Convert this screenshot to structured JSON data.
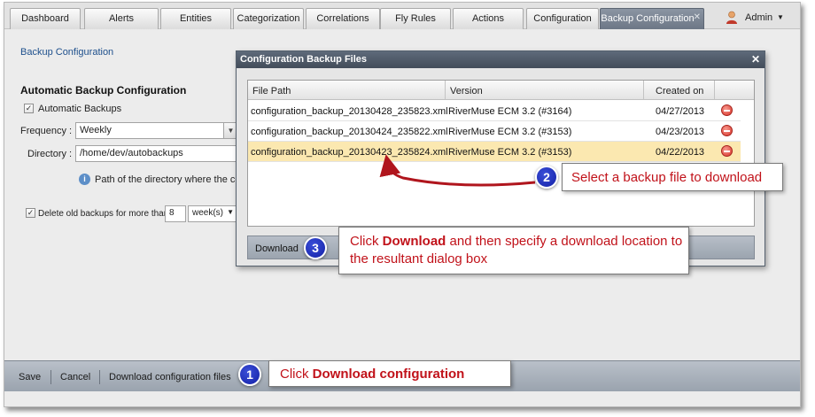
{
  "tabs": [
    {
      "label": "Dashboard",
      "active": false
    },
    {
      "label": "Alerts",
      "active": false
    },
    {
      "label": "Entities",
      "active": false
    },
    {
      "label": "Categorization",
      "active": false
    },
    {
      "label": "Correlations",
      "active": false
    },
    {
      "label": "Fly Rules",
      "active": false
    },
    {
      "label": "Actions",
      "active": false
    },
    {
      "label": "Configuration",
      "active": false
    },
    {
      "label": "Backup Configuration",
      "active": true
    }
  ],
  "user": {
    "name": "Admin",
    "icon": "user-icon"
  },
  "page": {
    "breadcrumb": "Backup Configuration",
    "section_title": "Automatic Backup Configuration",
    "automatic_backups_label": "Automatic Backups",
    "automatic_backups_checked": true,
    "frequency_label": "Frequency :",
    "frequency_value": "Weekly",
    "directory_label": "Directory :",
    "directory_value": "/home/dev/autobackups",
    "directory_help": "Path of the directory where the co",
    "delete_old_label": "Delete old backups for more than",
    "delete_old_checked": true,
    "delete_old_count": "8",
    "delete_old_unit": "week(s)"
  },
  "toolbar": {
    "save_label": "Save",
    "cancel_label": "Cancel",
    "download_config_label": "Download configuration files"
  },
  "modal": {
    "title": "Configuration Backup Files",
    "columns": [
      "File Path",
      "Version",
      "Created on"
    ],
    "rows": [
      {
        "file": "configuration_backup_20130428_235823.xml",
        "version": "RiverMuse ECM 3.2 (#3164)",
        "created": "04/27/2013",
        "selected": false
      },
      {
        "file": "configuration_backup_20130424_235822.xml",
        "version": "RiverMuse ECM 3.2 (#3153)",
        "created": "04/23/2013",
        "selected": false
      },
      {
        "file": "configuration_backup_20130423_235824.xml",
        "version": "RiverMuse ECM 3.2 (#3153)",
        "created": "04/22/2013",
        "selected": true
      }
    ],
    "download_label": "Download"
  },
  "callouts": [
    {
      "number": "1",
      "text_prefix": "Click ",
      "text_bold": "Download configuration",
      "text_suffix": ""
    },
    {
      "number": "2",
      "text_prefix": "Select a backup file to download",
      "text_bold": "",
      "text_suffix": ""
    },
    {
      "number": "3",
      "text_prefix": "Click ",
      "text_bold": "Download",
      "text_suffix": " and then specify a download location to the resultant dialog box"
    }
  ],
  "colors": {
    "callout_text": "#c1121a",
    "badge": "#1a2bbf",
    "selected_row": "#fbe8b0",
    "active_tab": "#7a8493"
  }
}
